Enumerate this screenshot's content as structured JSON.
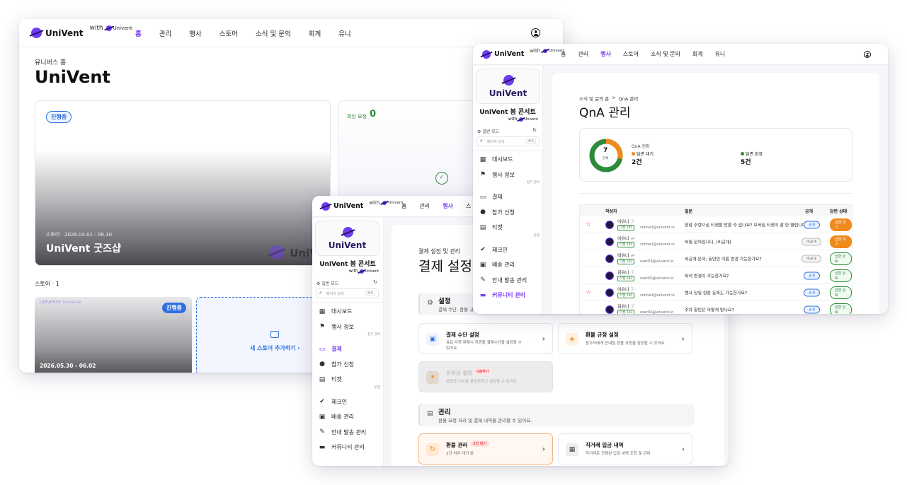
{
  "brand": {
    "name": "UniVent",
    "with": "with",
    "partner": "Univent"
  },
  "nav": {
    "items": [
      "홈",
      "관리",
      "행사",
      "스토어",
      "소식 및 문의",
      "회계",
      "유니"
    ],
    "items_short": [
      "홈",
      "관리",
      "행사",
      "스"
    ]
  },
  "colors": {
    "accent": "#7b3ff2",
    "green": "#2e8b3a",
    "orange": "#f08a1c",
    "blue": "#2f6fe0",
    "red": "#e5484d"
  },
  "home": {
    "breadcrumb": "유니버스 홈",
    "title": "UniVent",
    "hero": {
      "badge": "진행중",
      "date": "스토어 · 2026.04.01 - 06.30",
      "title": "UniVent 굿즈샵"
    },
    "confirm": {
      "label": "확인 요청",
      "count": "0"
    },
    "store_count_label": "스토어 · 1",
    "store_card": {
      "brand_text": "UNIVERSE Universe",
      "badge": "진행중",
      "date": "2026.05.30 - 06.02"
    },
    "add_store": "새 스토어 추가하기 ›"
  },
  "sidebar": {
    "event_logo": "UniVent",
    "event_name": "UniVent 봄 콘서트",
    "with": "with",
    "mode": "일반 모드",
    "search_placeholder": "페이지 검색",
    "search_shortcut": "⌘K",
    "items_top": [
      {
        "icon": "▦",
        "label": "대시보드"
      },
      {
        "icon": "⚑",
        "label": "행사 정보"
      }
    ],
    "group_join": "참가 관리",
    "items_join": [
      {
        "icon": "▭",
        "label": "결제"
      },
      {
        "icon": "●",
        "label": "참가 신청"
      },
      {
        "icon": "▤",
        "label": "티켓"
      }
    ],
    "group_ops": "운영",
    "items_ops": [
      {
        "icon": "✔",
        "label": "체크인"
      },
      {
        "icon": "▣",
        "label": "배송 관리"
      },
      {
        "icon": "✎",
        "label": "안내 발송 관리"
      },
      {
        "icon": "▬",
        "label": "커뮤니티 관리"
      }
    ]
  },
  "payment": {
    "breadcrumb": "결제 설정 및 관리",
    "title": "결제 설정",
    "settings": {
      "title": "설정",
      "desc": "결제 수단, 환불 규정 등"
    },
    "card_method": {
      "title": "결제 수단 설정",
      "desc1": "유료 티켓 판매시 지원할 결제수단을 설정할 수",
      "desc2": "있어요."
    },
    "card_refund_rule": {
      "title": "환불 규정 설정",
      "desc": "참가자에게 안내될 환불 규정을 설정할 수 있어요."
    },
    "card_support": {
      "title": "응원금 설정",
      "tag": "사용하기",
      "desc": "응원금 기능을 활성화하고 설정할 수 있어요."
    },
    "manage": {
      "title": "관리",
      "desc": "환불 요청 처리 및 결제 내역을 관리할 수 있어요."
    },
    "card_refund": {
      "title": "환불 관리",
      "tag": "2건 대기",
      "desc": "2건 처리 대기 중"
    },
    "card_deposit": {
      "title": "직거래 입금 내역",
      "desc": "직거래로 진행된 입금 내역 조회 및 관리"
    }
  },
  "qna": {
    "breadcrumb_1": "소식 및 문의 홈",
    "breadcrumb_sep": ">",
    "breadcrumb_2": "QnA 관리",
    "title": "QnA 관리",
    "summary": {
      "total": 7,
      "total_label": "전체",
      "heading": "QnA 현황",
      "pending_label": "답변 대기",
      "pending": 2,
      "pending_unit": "2건",
      "done_label": "답변 완료",
      "done": 5,
      "done_unit": "5건"
    },
    "columns": [
      "작성자",
      "질문",
      "공개",
      "답변 상태"
    ],
    "rows": [
      {
        "star": true,
        "name": "이유니",
        "mark": "ⓘ",
        "ticket": "티켓 285",
        "email": "contact@univent.io",
        "question": "현장 수령으로 티켓을 받을 수 있나요? 모바일 티켓이 잘 안 열립니다.",
        "public": "공개",
        "status": "답변 대기"
      },
      {
        "star": false,
        "name": "이유니",
        "mark": "☍",
        "ticket": "티켓 285",
        "email": "contact@univent.io",
        "question": "비밀 문의입니다. (비공개)",
        "public": "비공개",
        "status": "답변 대기"
      },
      {
        "star": false,
        "name": "박유니",
        "mark": "☍",
        "ticket": "티켓 282",
        "email": "user03@univent.io",
        "question": "비공개 문의: 동반인 이름 변경 가능한가요?",
        "public": "비공개",
        "status": "답변 완료"
      },
      {
        "star": false,
        "name": "김유니",
        "mark": "ⓘ",
        "ticket": "티켓 283",
        "email": "user02@univent.io",
        "question": "좌석 변경이 가능한가요?",
        "public": "공개",
        "status": "답변 완료"
      },
      {
        "star": true,
        "name": "이유니",
        "mark": "ⓘ",
        "ticket": "티켓 285",
        "email": "contact@univent.io",
        "question": "행사 당일 현장 등록도 가능한가요?",
        "public": "공개",
        "status": "답변 완료"
      },
      {
        "star": false,
        "name": "김유니",
        "mark": "ⓘ",
        "ticket": "티켓 283",
        "email": "user02@univent.io",
        "question": "주차 할인은 어떻게 받나요?",
        "public": "공개",
        "status": "답변 완료"
      }
    ]
  }
}
